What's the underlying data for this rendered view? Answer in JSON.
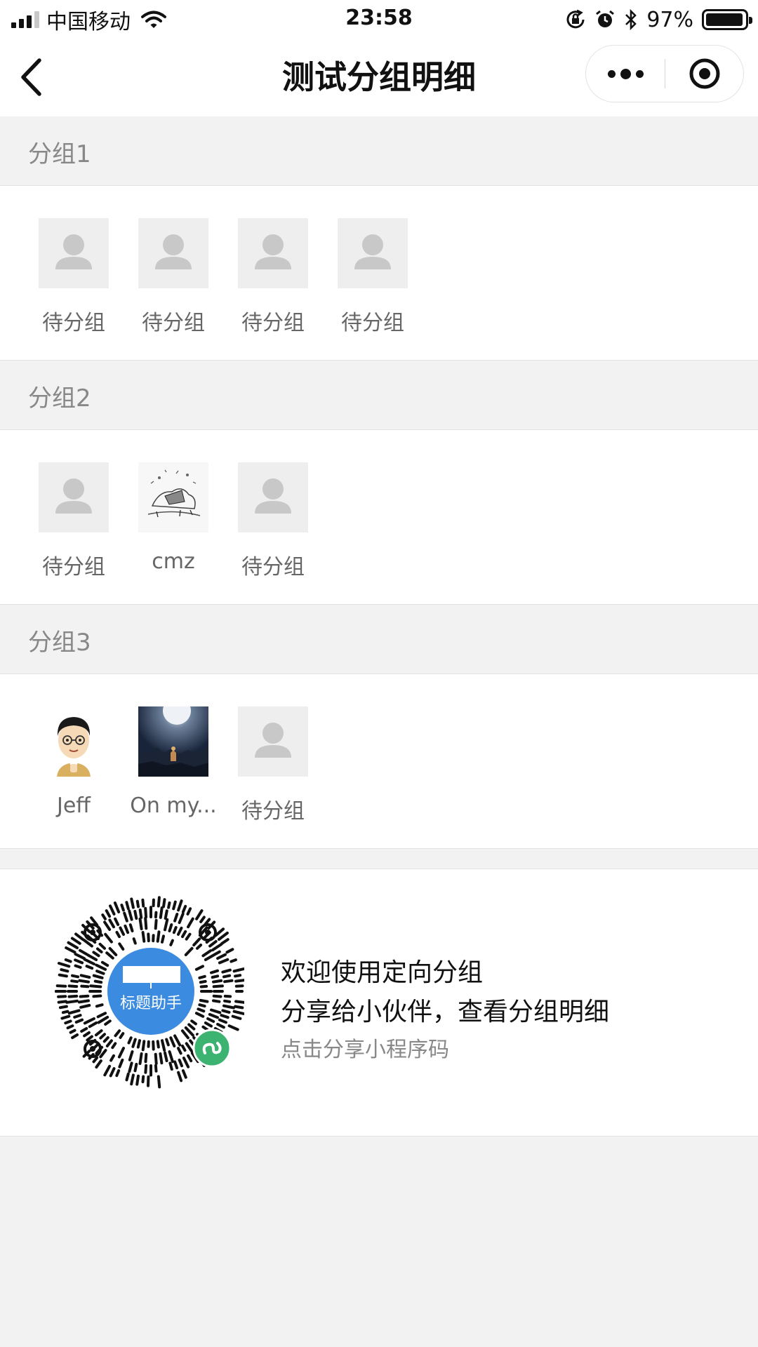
{
  "status_bar": {
    "carrier": "中国移动",
    "time": "23:58",
    "battery": "97%",
    "battery_level": 0.97
  },
  "nav": {
    "title": "测试分组明细"
  },
  "groups": [
    {
      "title": "分组1",
      "members": [
        {
          "name": "待分组",
          "avatar": "default-avatar"
        },
        {
          "name": "待分组",
          "avatar": "default-avatar"
        },
        {
          "name": "待分组",
          "avatar": "default-avatar"
        },
        {
          "name": "待分组",
          "avatar": "default-avatar"
        }
      ]
    },
    {
      "title": "分组2",
      "members": [
        {
          "name": "待分组",
          "avatar": "default-avatar"
        },
        {
          "name": "cmz",
          "avatar": "sketch-photo"
        },
        {
          "name": "待分组",
          "avatar": "default-avatar"
        }
      ]
    },
    {
      "title": "分组3",
      "members": [
        {
          "name": "Jeff",
          "avatar": "cartoon-glasses-man"
        },
        {
          "name": "On my...",
          "avatar": "night-moon-photo"
        },
        {
          "name": "待分组",
          "avatar": "default-avatar"
        }
      ]
    }
  ],
  "footer": {
    "qr_label": "标题助手",
    "line1": "欢迎使用定向分组",
    "line2": "分享给小伙伴，查看分组明细",
    "line3": "点击分享小程序码"
  },
  "colors": {
    "page_bg": "#f2f2f2",
    "card_bg": "#ffffff",
    "muted_text": "#888888",
    "qr_blue": "#3b8be0",
    "mini_program_green": "#3cb371"
  }
}
